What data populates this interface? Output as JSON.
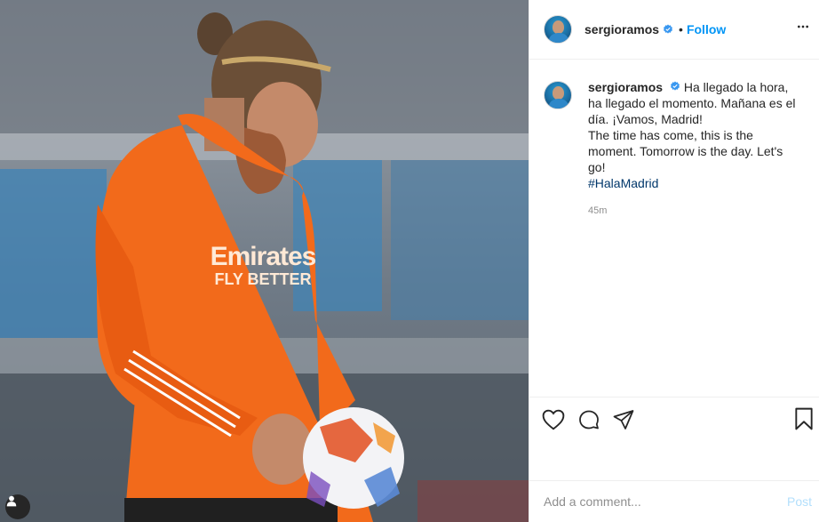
{
  "post": {
    "username": "sergioramos",
    "follow_label": "Follow",
    "separator": "•",
    "caption_lines": "Ha llegado la hora, ha llegado el momento. Mañana es el día. ¡Vamos, Madrid!\nThe time has come, this is the moment. Tomorrow is the day. Let's go!\n",
    "hashtag": "#HalaMadrid",
    "timestamp": "45m"
  },
  "photo": {
    "shirt_text_line1": "Emirates",
    "shirt_text_line2": "FLY BETTER"
  },
  "actions": {
    "like_icon": "heart-icon",
    "comment_icon": "comment-icon",
    "share_icon": "paper-plane-icon",
    "save_icon": "bookmark-icon"
  },
  "comment": {
    "placeholder": "Add a comment...",
    "post_label": "Post"
  },
  "colors": {
    "accent": "#0095f6",
    "verified": "#3897f0",
    "jersey": "#f26a1b",
    "hashtag": "#00376b"
  }
}
